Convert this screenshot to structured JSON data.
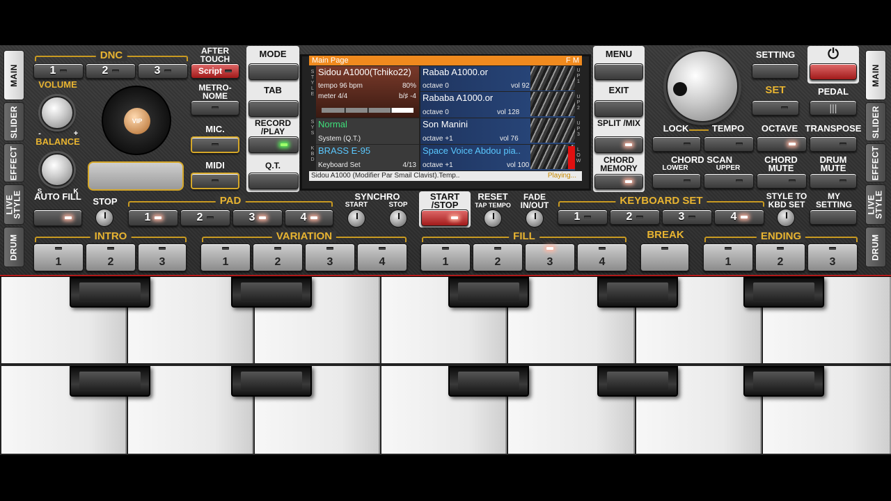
{
  "side_tabs_left": [
    "MAIN",
    "SLIDER",
    "EFFECT",
    "LIVE STYLE",
    "DRUM"
  ],
  "side_tabs_right": [
    "MAIN",
    "SLIDER",
    "EFFECT",
    "LIVE STYLE",
    "DRUM"
  ],
  "left": {
    "dnc_label": "DNC",
    "dnc_buttons": [
      "1",
      "2",
      "3"
    ],
    "after_touch_label": "AFTER TOUCH",
    "script_label": "Script",
    "volume_label": "VOLUME",
    "balance_label": "BALANCE",
    "minus": "-",
    "plus": "+",
    "s": "S",
    "k": "K",
    "metronome_label": "METRO- NOME",
    "mic_label": "MIC.",
    "midi_label": "MIDI",
    "logo_text": "VIP"
  },
  "center_left": {
    "mode": "MODE",
    "tab": "TAB",
    "record_play": "RECORD /PLAY",
    "qt": "Q.T."
  },
  "lcd": {
    "title": "Main Page",
    "fm": "F M",
    "style": {
      "name": "Sidou A1000(Tchiko22)",
      "tempo": "tempo 96 bpm",
      "percent": "80%",
      "meter": "meter 4/4",
      "key": "b/♯ -4"
    },
    "upper1": {
      "name": "Rabab A1000.or",
      "octave": "octave  0",
      "vol": "vol 92"
    },
    "upper2": {
      "name": "Rababa A1000.or",
      "octave": "octave  0",
      "vol": "vol 128"
    },
    "system": {
      "name": "Normal",
      "sub": "System (Q.T.)"
    },
    "upper3": {
      "name": "Son Manini",
      "octave": "octave +1",
      "vol": "vol 76"
    },
    "kbd": {
      "name": "BRASS E-95",
      "sub": "Keyboard Set",
      "page": "4/13"
    },
    "lower": {
      "name": "Space Voice Abdou pia..",
      "octave": "octave +1",
      "vol": "vol 100"
    },
    "side_style": "STYLE",
    "side_sys": "SYS",
    "side_kbd": "KBD",
    "side_up1": "UP1",
    "side_up2": "UP2",
    "side_up3": "UP3",
    "side_low": "LOW",
    "status": "Sidou A1000 (Modifier Par Smail Clavist).Temp..",
    "playing": "Playing..."
  },
  "center_right": {
    "menu": "MENU",
    "exit": "EXIT",
    "split_mix": "SPLIT /MIX",
    "chord_memory": "CHORD MEMORY"
  },
  "right": {
    "setting": "SETTING",
    "set": "SET",
    "pedal": "PEDAL",
    "lock": "LOCK",
    "tempo": "TEMPO",
    "octave": "OCTAVE",
    "transpose": "TRANSPOSE",
    "chord_scan": "CHORD SCAN",
    "lower": "LOWER",
    "upper": "UPPER",
    "chord_mute": "CHORD MUTE",
    "drum_mute": "DRUM MUTE",
    "power_icon": "⏻"
  },
  "row_mid": {
    "auto_fill": "AUTO FILL",
    "stop": "STOP",
    "pad": "PAD",
    "pad_buttons": [
      "1",
      "2",
      "3",
      "4"
    ],
    "synchro": "SYNCHRO",
    "start": "START",
    "stop2": "STOP",
    "start_stop": "START /STOP",
    "reset": "RESET",
    "tap_tempo": "TAP TEMPO",
    "fade": "FADE IN/OUT",
    "keyboard_set": "KEYBOARD SET",
    "kbd_buttons": [
      "1",
      "2",
      "3",
      "4"
    ],
    "style_to_kbd": "STYLE TO KBD SET",
    "my_setting": "MY SETTING"
  },
  "row_bottom": {
    "intro": "INTRO",
    "intro_buttons": [
      "1",
      "2",
      "3"
    ],
    "variation": "VARIATION",
    "variation_buttons": [
      "1",
      "2",
      "3",
      "4"
    ],
    "fill": "FILL",
    "fill_buttons": [
      "1",
      "2",
      "3",
      "4"
    ],
    "break": "BREAK",
    "ending": "ENDING",
    "ending_buttons": [
      "1",
      "2",
      "3"
    ]
  }
}
